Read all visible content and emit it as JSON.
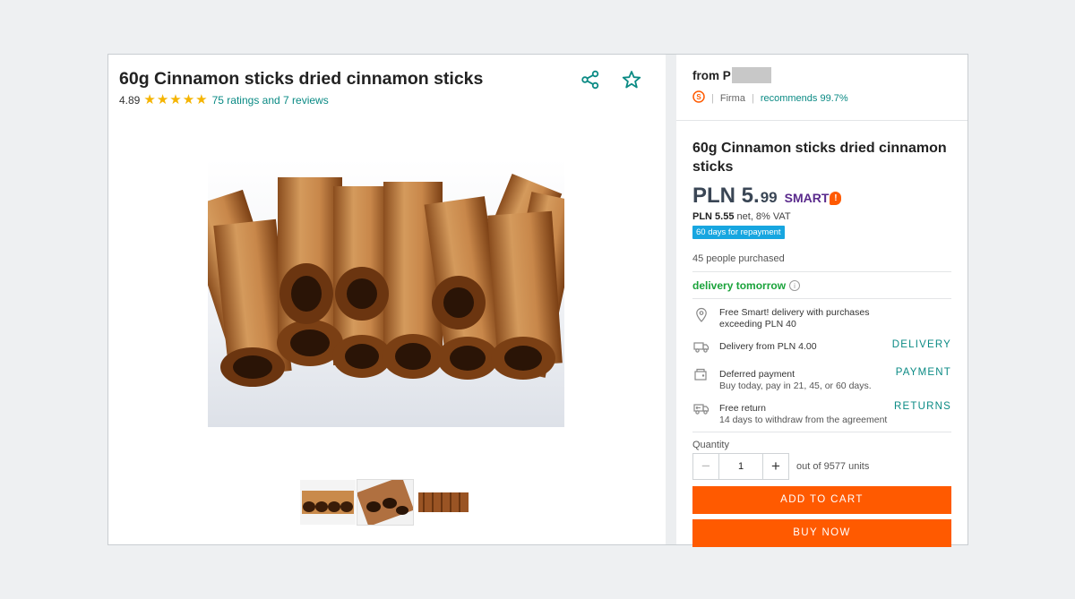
{
  "product": {
    "title": "60g Cinnamon sticks dried cinnamon sticks",
    "rating_value": "4.89",
    "rating_stars": 5,
    "rating_link": "75 ratings and 7 reviews"
  },
  "seller": {
    "name_prefix": "from P",
    "type": "Firma",
    "recommends": "recommends 99.7%"
  },
  "offer": {
    "title": "60g Cinnamon sticks dried cinnamon sticks",
    "price_main": "PLN 5.",
    "price_cents": "99",
    "smart_label": "SMART",
    "smart_badge": "!",
    "net_price": "PLN 5.55",
    "net_suffix": " net, 8% VAT",
    "repayment_badge": "60 days for repayment",
    "purchased": "45 people purchased",
    "delivery_tomorrow": "delivery tomorrow"
  },
  "features": [
    {
      "line1": "Free Smart! delivery with purchases",
      "line2": "exceeding PLN 40",
      "link": ""
    },
    {
      "line1": "Delivery from PLN 4.00",
      "line2": "",
      "link": "DELIVERY"
    },
    {
      "line1": "Deferred payment",
      "line2": "Buy today, pay in 21, 45, or 60 days.",
      "link": "PAYMENT"
    },
    {
      "line1": "Free return",
      "line2": "14 days to withdraw from the agreement",
      "link": "RETURNS"
    }
  ],
  "quantity": {
    "label": "Quantity",
    "value": "1",
    "available": "out of 9577 units"
  },
  "buttons": {
    "add_to_cart": "ADD TO CART",
    "buy_now": "BUY NOW"
  },
  "colors": {
    "accent": "#ff5a00",
    "link": "#0a8a84",
    "star": "#f5b400",
    "delivery": "#1aa33b",
    "repay_badge": "#17a6e0"
  }
}
